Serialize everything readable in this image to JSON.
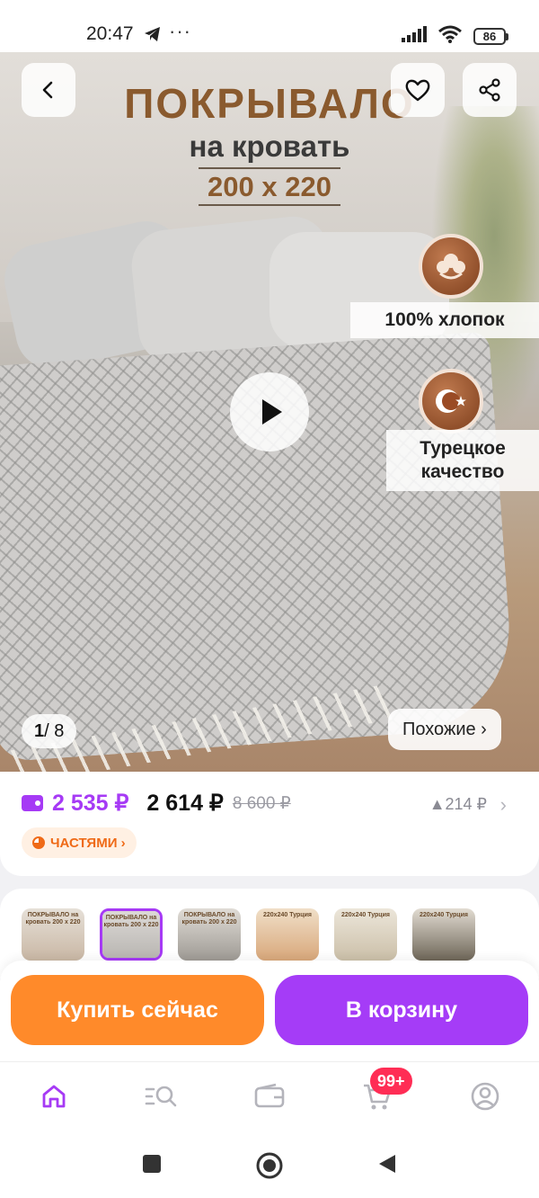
{
  "status_bar": {
    "time": "20:47",
    "dots": "···",
    "battery": "86"
  },
  "hero": {
    "title_line1": "ПОКРЫВАЛО",
    "title_line2": "на кровать",
    "size": "200 x 220",
    "feature_cotton": "100% хлопок",
    "feature_turkey_line1": "Турецкое",
    "feature_turkey_line2": "качество",
    "counter_current": "1",
    "counter_total": "/ 8",
    "similar_label": "Похожие ›"
  },
  "price": {
    "wallet_price": "2 535 ₽",
    "price": "2 614 ₽",
    "old_price": "8 600 ₽",
    "discount": "▲214 ₽",
    "parts_label": "ЧАСТЯМИ ›"
  },
  "thumbnails": [
    {
      "text": "ПОКРЫВАЛО на кровать 200 x 220",
      "selected": false
    },
    {
      "text": "ПОКРЫВАЛО на кровать 200 x 220",
      "selected": true
    },
    {
      "text": "ПОКРЫВАЛО на кровать 200 x 220",
      "selected": false
    },
    {
      "text": "220x240 Турция",
      "selected": false
    },
    {
      "text": "220x240 Турция",
      "selected": false
    },
    {
      "text": "220x240 Турция",
      "selected": false
    }
  ],
  "actions": {
    "buy_now": "Купить сейчас",
    "add_to_cart": "В корзину"
  },
  "bottom_nav": {
    "cart_badge": "99+",
    "accent_color": "#a63af5"
  },
  "colors": {
    "purple": "#a63af5",
    "orange": "#ff8a2a",
    "badge_red": "#ff2d55"
  }
}
